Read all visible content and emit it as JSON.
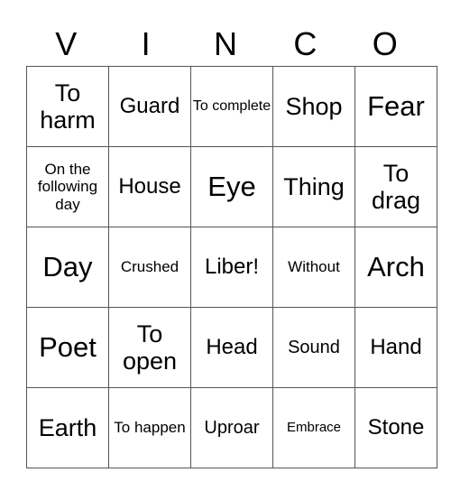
{
  "header": [
    "V",
    "I",
    "N",
    "C",
    "O"
  ],
  "rows": [
    [
      "To harm",
      "Guard",
      "To complete",
      "Shop",
      "Fear"
    ],
    [
      "On the following day",
      "House",
      "Eye",
      "Thing",
      "To drag"
    ],
    [
      "Day",
      "Crushed",
      "Liber!",
      "Without",
      "Arch"
    ],
    [
      "Poet",
      "To open",
      "Head",
      "Sound",
      "Hand"
    ],
    [
      "Earth",
      "To happen",
      "Uproar",
      "Embrace",
      "Stone"
    ]
  ]
}
